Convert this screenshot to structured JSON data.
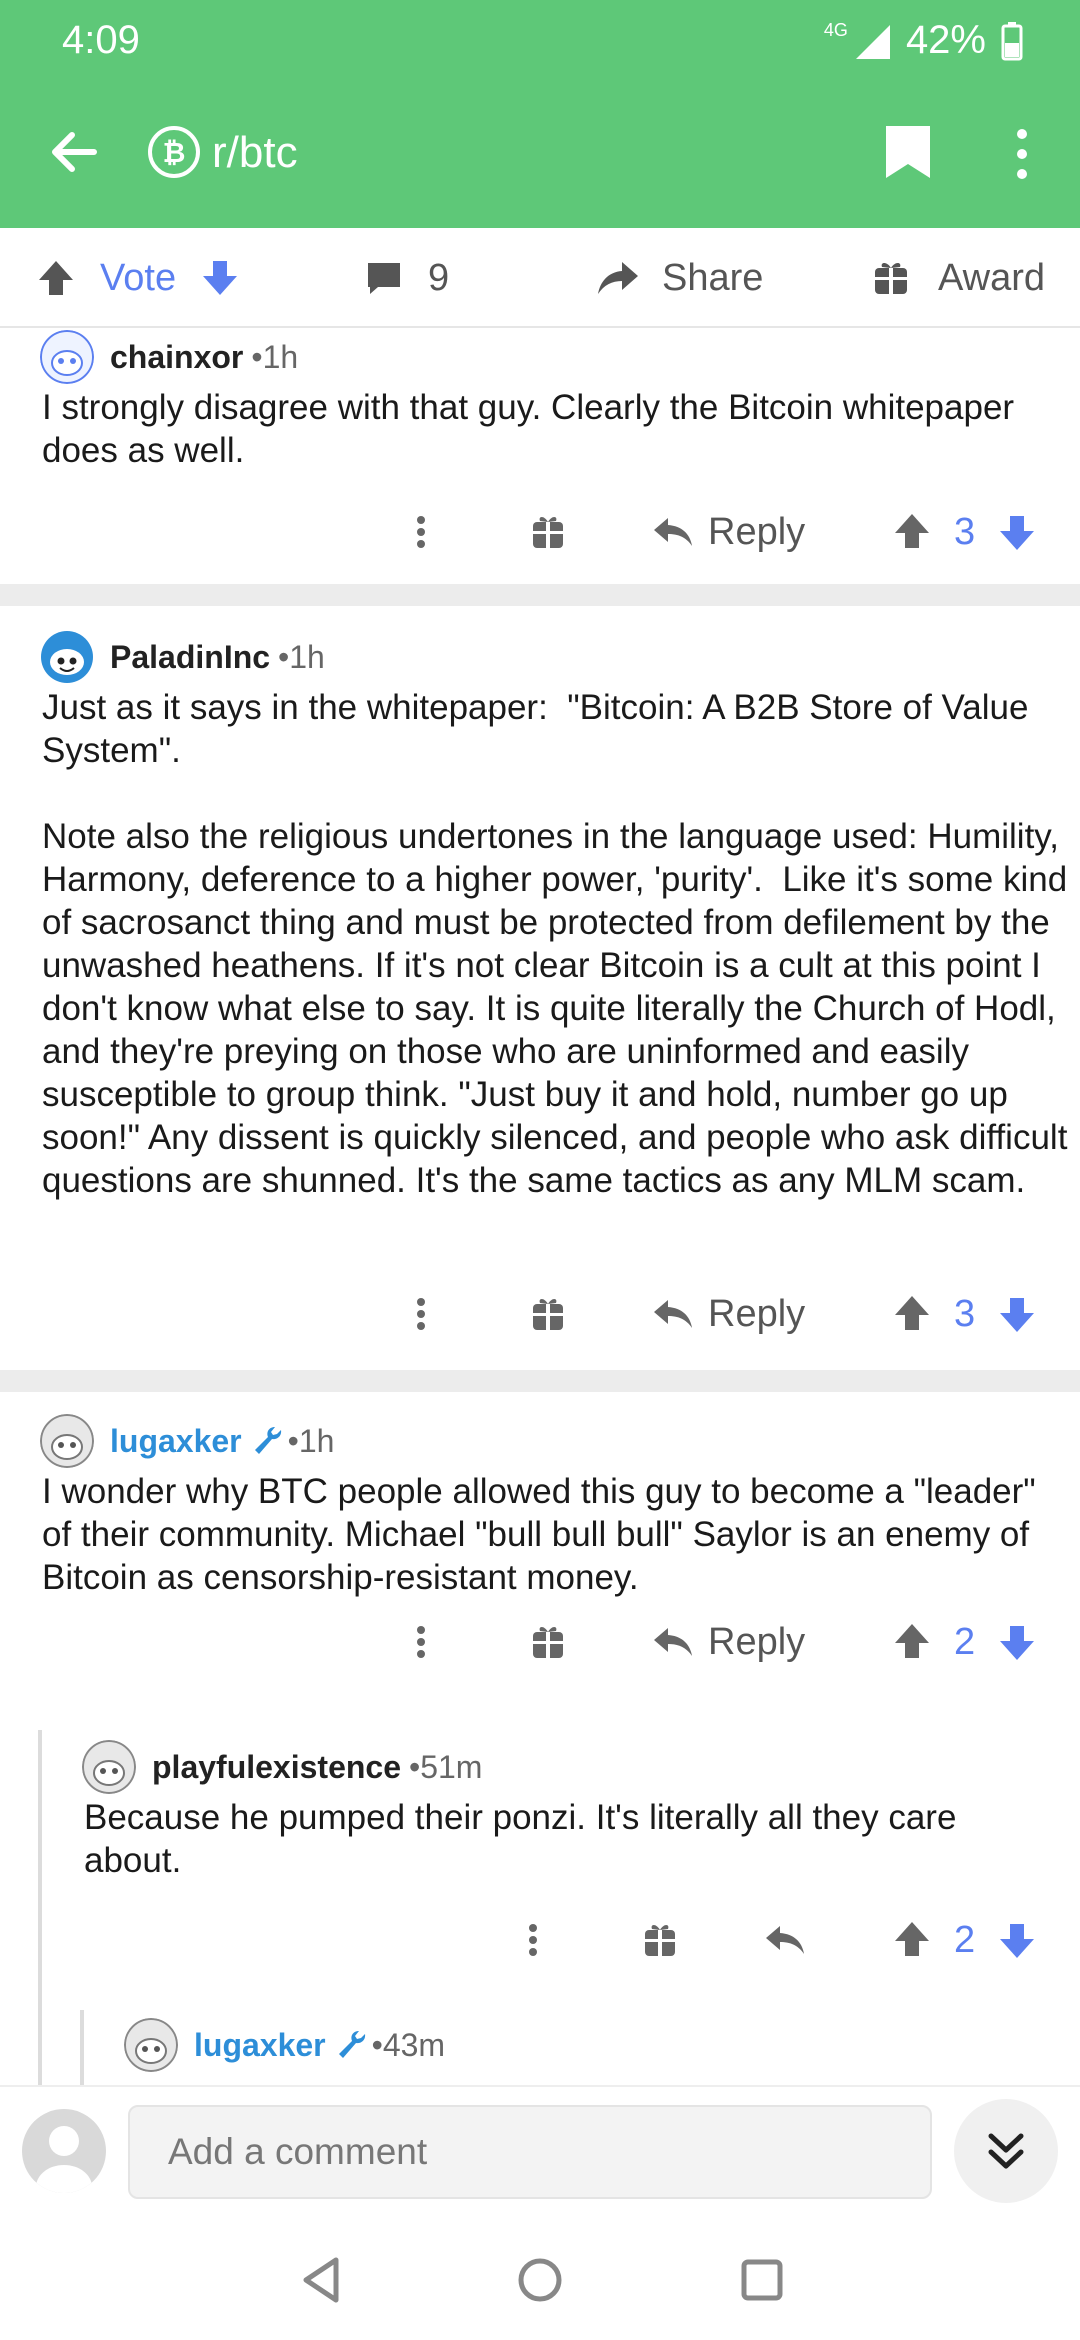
{
  "status": {
    "time": "4:09",
    "network": "4G",
    "battery": "42%"
  },
  "appbar": {
    "subreddit": "r/btc"
  },
  "actions": {
    "vote": "Vote",
    "comments": "9",
    "share": "Share",
    "award": "Award"
  },
  "comments": [
    {
      "author": "chainxor",
      "time": "1h",
      "mod": false,
      "body": "I strongly disagree with that guy. Clearly the Bitcoin whitepaper does as well.",
      "reply": "Reply",
      "score": "3"
    },
    {
      "author": "PaladinInc",
      "time": "1h",
      "mod": false,
      "body": "Just as it says in the whitepaper:  \"Bitcoin: A B2B Store of Value System\".\n\nNote also the religious undertones in the language used: Humility, Harmony, deference to a higher power, 'purity'.  Like it's some kind of sacrosanct thing and must be protected from defilement by the unwashed heathens. If it's not clear Bitcoin is a cult at this point I don't know what else to say. It is quite literally the Church of Hodl, and they're preying on those who are uninformed and easily susceptible to group think. \"Just buy it and hold, number go up soon!\" Any dissent is quickly silenced, and people who ask difficult questions are shunned. It's the same tactics as any MLM scam.",
      "reply": "Reply",
      "score": "3"
    },
    {
      "author": "lugaxker",
      "time": "1h",
      "mod": true,
      "body": "I wonder why BTC people allowed this guy to become a \"leader\" of their community. Michael \"bull bull bull\" Saylor is an enemy of Bitcoin as censorship-resistant money.",
      "reply": "Reply",
      "score": "2"
    },
    {
      "author": "playfulexistence",
      "time": "51m",
      "mod": false,
      "body": "Because he pumped their ponzi. It's literally all they care about.",
      "score": "2"
    },
    {
      "author": "lugaxker",
      "time": "43m",
      "mod": true
    }
  ],
  "composer": {
    "placeholder": "Add a comment"
  },
  "colors": {
    "brand": "#5ec878",
    "accent": "#5b7ff0",
    "mod": "#2d8ed8"
  }
}
